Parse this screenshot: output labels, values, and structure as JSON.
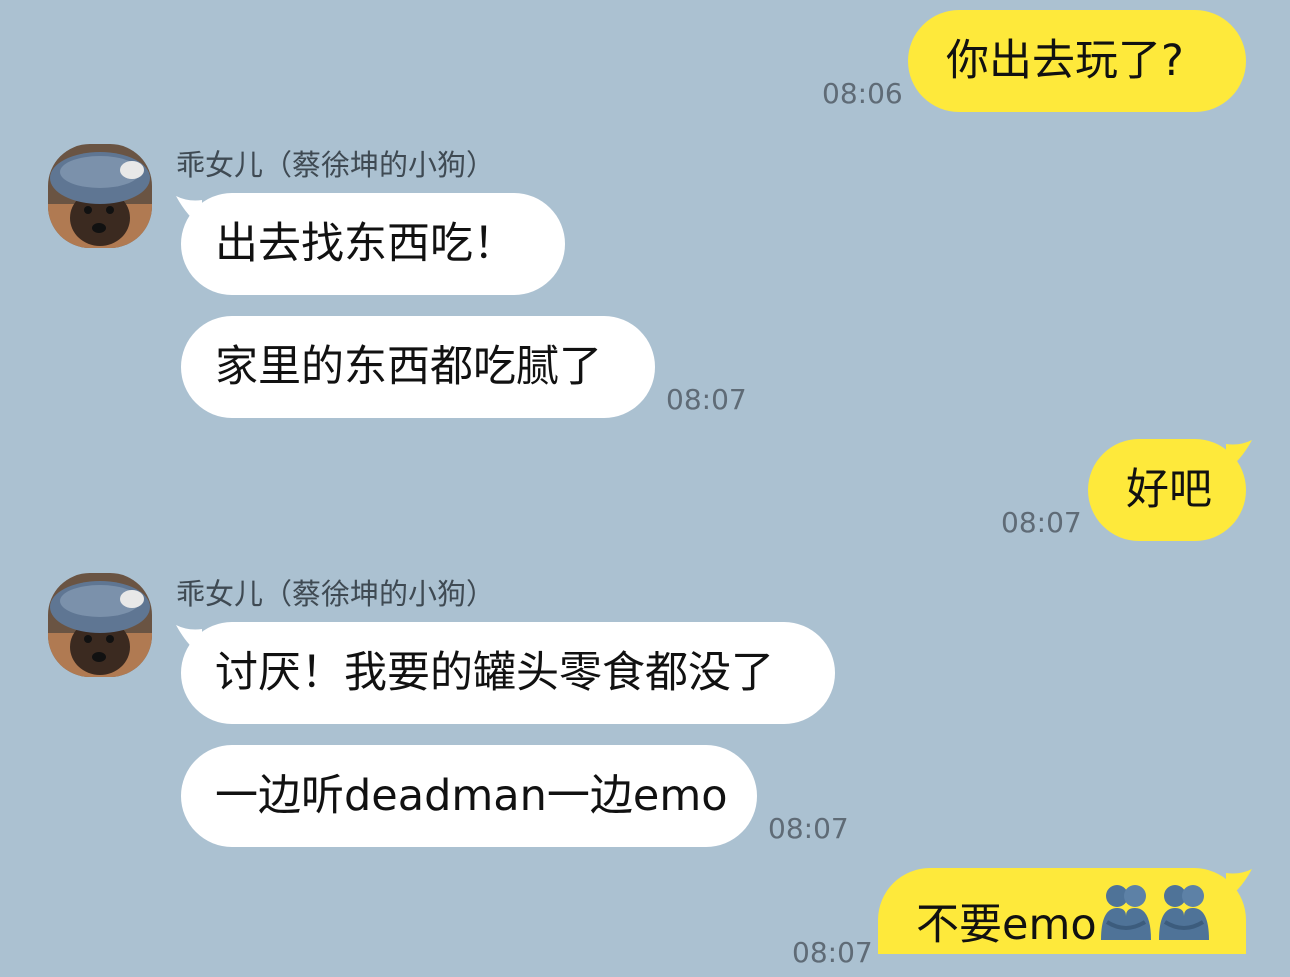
{
  "contact": {
    "name": "乖女儿（蔡徐坤的小狗）"
  },
  "messages": [
    {
      "id": "m1",
      "direction": "out",
      "text": "你出去玩了?",
      "time": "08:06"
    },
    {
      "id": "m2",
      "direction": "in",
      "text": "出去找东西吃！"
    },
    {
      "id": "m3",
      "direction": "in",
      "text": "家里的东西都吃腻了",
      "time": "08:07"
    },
    {
      "id": "m4",
      "direction": "out",
      "text": "好吧",
      "time": "08:07"
    },
    {
      "id": "m5",
      "direction": "in",
      "text": "讨厌！我要的罐头零食都没了"
    },
    {
      "id": "m6",
      "direction": "in",
      "text": "一边听deadman一边emo",
      "time": "08:07"
    },
    {
      "id": "m7",
      "direction": "out",
      "text": "不要emo",
      "emoji": [
        "hug-emoji",
        "hug-emoji"
      ],
      "time": "08:07"
    }
  ],
  "colors": {
    "background": "#abc1d1",
    "incoming_bubble": "#ffffff",
    "outgoing_bubble": "#fee93b",
    "timestamp": "#5f6b76",
    "sender_name": "#3f4a53"
  }
}
